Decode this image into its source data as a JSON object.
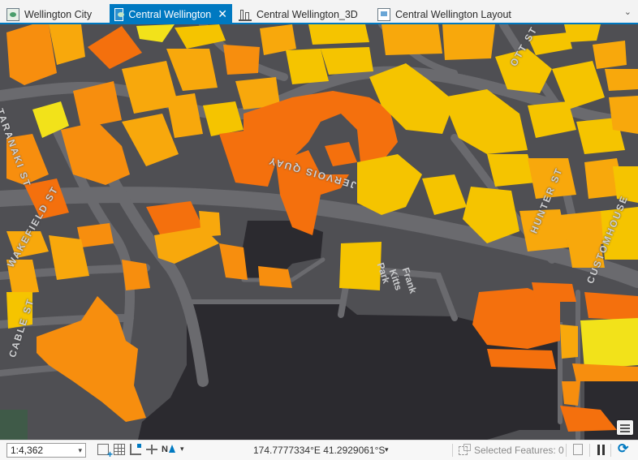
{
  "tabs": [
    {
      "label": "Wellington City",
      "icon": "map-icon",
      "active": false
    },
    {
      "label": "Central Wellington",
      "icon": "map-icon",
      "active": true,
      "close_glyph": "✕"
    },
    {
      "label": "Central Wellington_3D",
      "icon": "scene-icon",
      "active": false
    },
    {
      "label": "Central Wellington Layout",
      "icon": "layout-icon",
      "active": false
    }
  ],
  "tab_overflow_glyph": "⌄",
  "map": {
    "street_labels": [
      "TARANAKI ST",
      "WAKEFIELD ST",
      "CABLE ST",
      "JERVOIS QUAY",
      "HUNTER ST",
      "CUSTOMHOUSE",
      "OTT ST"
    ],
    "park_label": [
      "Frank",
      "Kitts",
      "Park"
    ],
    "colors": {
      "background": "#4f4f53",
      "road": "#6a6a6e",
      "water": "#2b2a2f",
      "park": "#3f4a42",
      "building_yellow": "#f2e21a",
      "building_gold": "#f5c400",
      "building_amber": "#f8a80c",
      "building_orange": "#f78e0e",
      "building_deep_orange": "#f4700d"
    }
  },
  "status": {
    "scale": "1:4,362",
    "coordinates": "174.7777334°E 41.2929061°S",
    "selected_features": "Selected Features: 0",
    "dropdown_glyph": "▾"
  }
}
